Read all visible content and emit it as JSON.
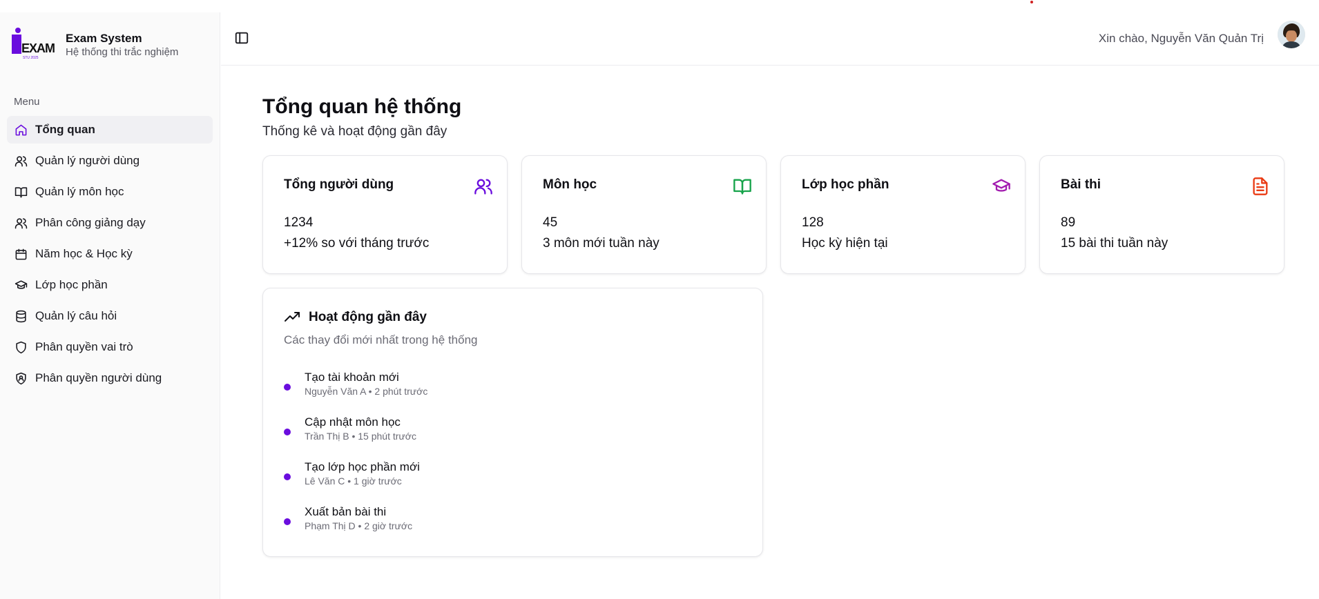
{
  "brand": {
    "logo_text": "EXAM",
    "logo_sub": "STU 2025",
    "title": "Exam System",
    "subtitle": "Hệ thống thi trắc nghiệm",
    "accent": "#6a0dde"
  },
  "sidebar": {
    "menu_label": "Menu",
    "items": [
      {
        "label": "Tổng quan",
        "icon": "home-icon",
        "active": true
      },
      {
        "label": "Quản lý người dùng",
        "icon": "users-icon"
      },
      {
        "label": "Quản lý môn học",
        "icon": "book-icon"
      },
      {
        "label": "Phân công giảng dạy",
        "icon": "users-icon"
      },
      {
        "label": "Năm học & Học kỳ",
        "icon": "calendar-icon"
      },
      {
        "label": "Lớp học phần",
        "icon": "graduation-cap-icon"
      },
      {
        "label": "Quản lý câu hỏi",
        "icon": "database-icon"
      },
      {
        "label": "Phân quyền vai trò",
        "icon": "shield-icon"
      },
      {
        "label": "Phân quyền người dùng",
        "icon": "shield-user-icon"
      }
    ]
  },
  "header": {
    "greeting": "Xin chào, Nguyễn Văn Quản Trị"
  },
  "page": {
    "title": "Tổng quan hệ thống",
    "subtitle": "Thống kê và hoạt động gần đây"
  },
  "stats": [
    {
      "title": "Tổng người dùng",
      "value": "1234",
      "note": "+12% so với tháng trước",
      "icon": "users-icon",
      "color": "#6a0dde"
    },
    {
      "title": "Môn học",
      "value": "45",
      "note": "3 môn mới tuần này",
      "icon": "book-open-icon",
      "color": "#16a34a"
    },
    {
      "title": "Lớp học phần",
      "value": "128",
      "note": "Học kỳ hiện tại",
      "icon": "graduation-cap-icon",
      "color": "#a21caf"
    },
    {
      "title": "Bài thi",
      "value": "89",
      "note": "15 bài thi tuần này",
      "icon": "file-text-icon",
      "color": "#ea3b14"
    }
  ],
  "activity": {
    "title": "Hoạt động gần đây",
    "description": "Các thay đổi mới nhất trong hệ thống",
    "items": [
      {
        "name": "Tạo tài khoản mới",
        "meta": "Nguyễn Văn A • 2 phút trước"
      },
      {
        "name": "Cập nhật môn học",
        "meta": "Trần Thị B • 15 phút trước"
      },
      {
        "name": "Tạo lớp học phần mới",
        "meta": "Lê Văn C • 1 giờ trước"
      },
      {
        "name": "Xuất bản bài thi",
        "meta": "Phạm Thị D • 2 giờ trước"
      }
    ]
  }
}
